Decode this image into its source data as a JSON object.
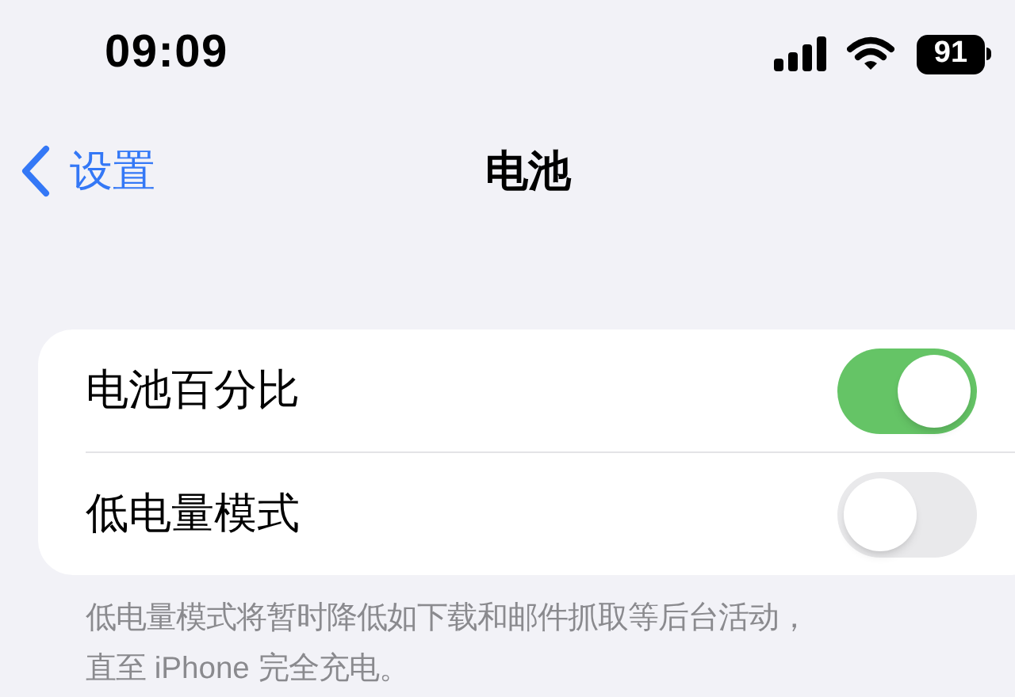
{
  "status_bar": {
    "time": "09:09",
    "battery": "91"
  },
  "nav": {
    "back": "设置",
    "title": "电池"
  },
  "settings": [
    {
      "label": "电池百分比",
      "on": true
    },
    {
      "label": "低电量模式",
      "on": false
    }
  ],
  "footer_lines": [
    "低电量模式将暂时降低如下载和邮件抓取等后台活动，",
    "直至 iPhone 完全充电。"
  ]
}
